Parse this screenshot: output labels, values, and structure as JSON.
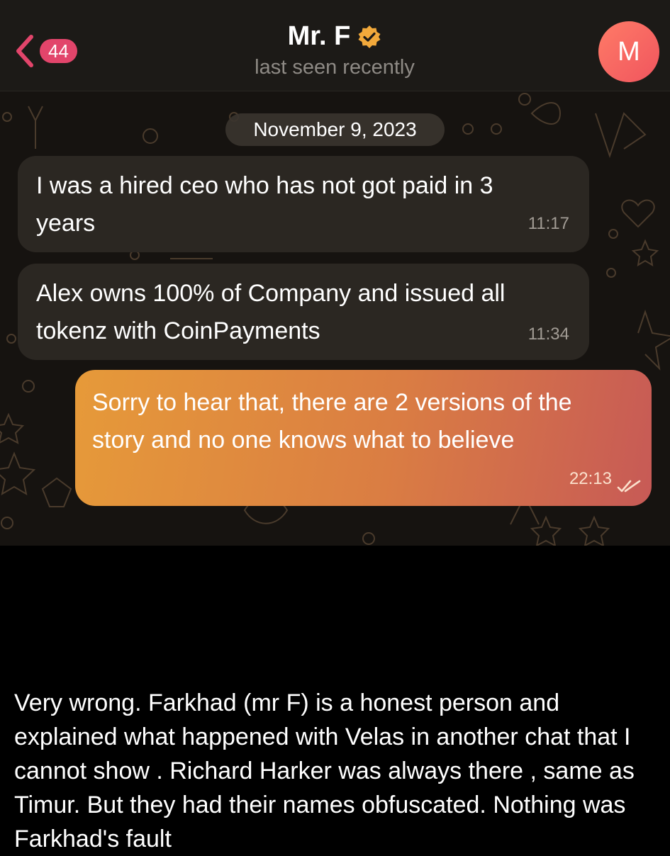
{
  "header": {
    "back_count": "44",
    "contact_name": "Mr. F",
    "status": "last seen recently",
    "avatar_letter": "M",
    "verified_icon": "verified-badge-icon"
  },
  "chat": {
    "date": "November 9, 2023",
    "messages": [
      {
        "direction": "in",
        "text": "I was a hired ceo who has not got paid in 3 years",
        "time": "11:17"
      },
      {
        "direction": "in",
        "text": "Alex owns 100% of Company and issued all tokenz with CoinPayments",
        "time": "11:34"
      },
      {
        "direction": "out",
        "text": "Sorry to hear that, there are 2 versions of the story and no one knows what to believe",
        "time": "22:13",
        "status_icon": "double-check-icon"
      }
    ]
  },
  "caption": "Very wrong. Farkhad (mr F) is a honest person and explained what happened with Velas in another chat that I cannot show . Richard Harker was always there , same as Timur. But they had their names obfuscated. Nothing was Farkhad's fault",
  "colors": {
    "badge": "#e2456b",
    "accent_back": "#e2456b",
    "bubble_in": "#2b2722",
    "bubble_out_start": "#e69a39",
    "bubble_out_end": "#c75a56",
    "avatar": "#f0555e"
  }
}
